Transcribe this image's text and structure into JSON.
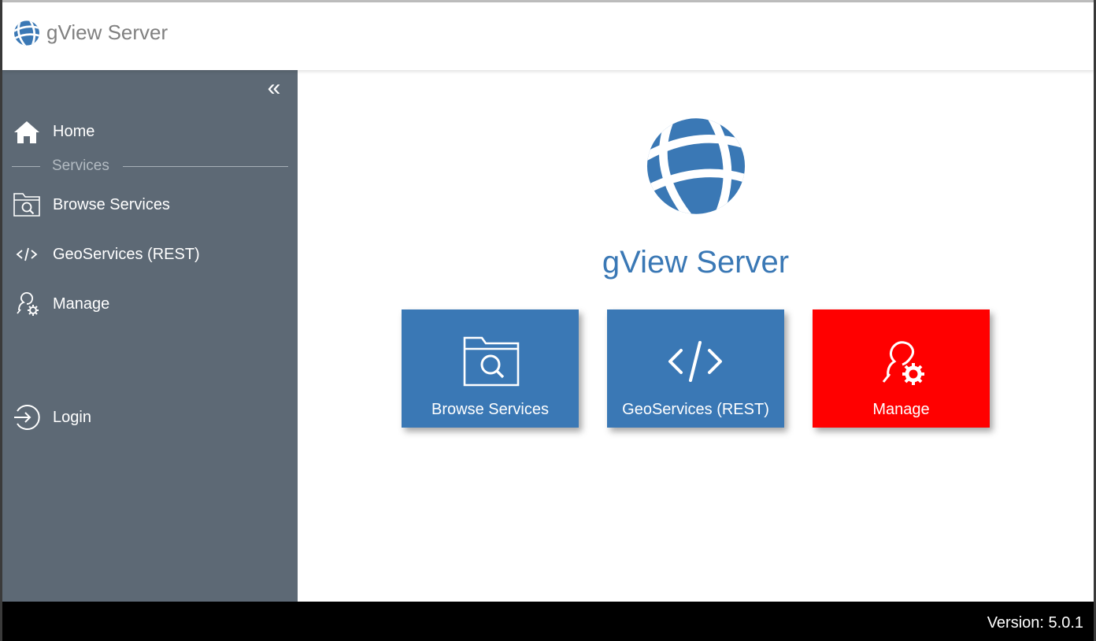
{
  "app": {
    "title": "gView Server",
    "colors": {
      "brand_blue": "#3a78b5",
      "sidebar_bg": "#5d6975",
      "manage_red": "#ff0000",
      "footer_bg": "#000000"
    }
  },
  "sidebar": {
    "collapse_label": "«",
    "items": [
      {
        "label": "Home",
        "icon": "home-icon"
      },
      {
        "label": "Browse Services",
        "icon": "folder-search-icon"
      },
      {
        "label": "GeoServices (REST)",
        "icon": "code-icon"
      },
      {
        "label": "Manage",
        "icon": "user-gear-icon"
      },
      {
        "label": "Login",
        "icon": "login-icon"
      }
    ],
    "section_label": "Services"
  },
  "main": {
    "title": "gView Server",
    "tiles": [
      {
        "label": "Browse Services",
        "icon": "folder-search-icon",
        "color": "#3a78b5"
      },
      {
        "label": "GeoServices (REST)",
        "icon": "code-icon",
        "color": "#3a78b5"
      },
      {
        "label": "Manage",
        "icon": "user-gear-icon",
        "color": "#ff0000"
      }
    ]
  },
  "footer": {
    "version": "Version: 5.0.1"
  }
}
